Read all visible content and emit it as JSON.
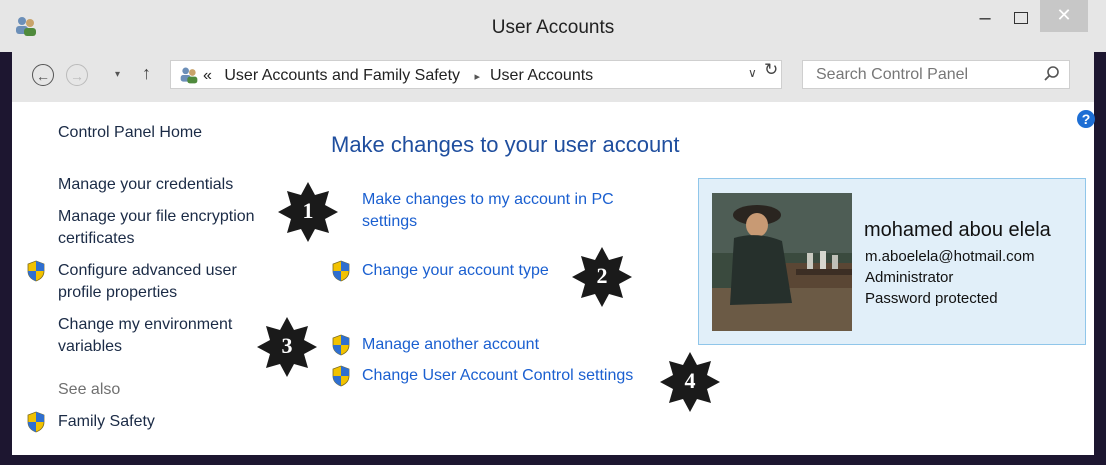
{
  "window": {
    "title": "User Accounts",
    "minimize_label": "–",
    "close_label": "✕"
  },
  "toolbar": {
    "back_icon": "←",
    "forward_icon": "→",
    "recent_icon": "▾",
    "up_icon": "↑",
    "crumb_overflow": "«",
    "crumbs": [
      "User Accounts and Family Safety",
      "User Accounts"
    ],
    "crumb_separator": "▸",
    "address_dropdown": "∨",
    "refresh_icon": "↻",
    "search_placeholder": "Search Control Panel"
  },
  "help_label": "?",
  "sidebar": {
    "home": "Control Panel Home",
    "links": [
      {
        "label": "Manage your credentials",
        "shield": false
      },
      {
        "line1": "Manage your file encryption",
        "line2": "certificates",
        "shield": false
      },
      {
        "line1": "Configure advanced user",
        "line2": "profile properties",
        "shield": true
      },
      {
        "line1": "Change my environment",
        "line2": "variables",
        "shield": false
      }
    ],
    "see_also": "See also",
    "family_safety": "Family Safety"
  },
  "main": {
    "title": "Make changes to your user account",
    "tasks": [
      {
        "line1": "Make changes to my account in PC",
        "line2": "settings",
        "shield": false
      },
      {
        "label": "Change your account type",
        "shield": true
      },
      {
        "label": "Manage another account",
        "shield": true
      },
      {
        "label": "Change User Account Control settings",
        "shield": true
      }
    ]
  },
  "account": {
    "name": "mohamed abou elela",
    "email": "m.aboelela@hotmail.com",
    "role": "Administrator",
    "password_status": "Password protected"
  },
  "badges": [
    "1",
    "2",
    "3",
    "4"
  ],
  "colors": {
    "link": "#1a5fd0",
    "title": "#1f4e9e",
    "card_bg": "#e1eff9",
    "card_border": "#90c6ea",
    "frame": "#1d1630",
    "chrome": "#e6e6e6"
  }
}
